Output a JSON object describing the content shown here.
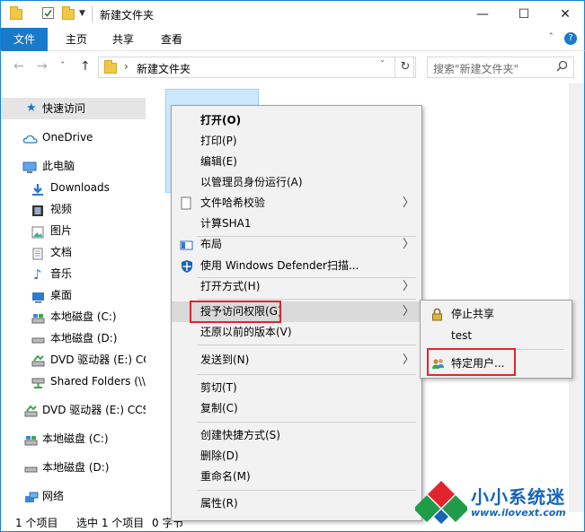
{
  "window": {
    "title": "新建文件夹",
    "min": "—",
    "max": "☐",
    "close": "✕"
  },
  "ribbon": {
    "tabs": [
      "文件",
      "主页",
      "共享",
      "查看"
    ],
    "help": "?",
    "collapse": "ˆ"
  },
  "address": {
    "back": "←",
    "forward": "→",
    "recent": "ˇ",
    "up": "↑",
    "sep": "›",
    "path": "新建文件夹",
    "dropdown": "ˇ",
    "refresh": "↻",
    "search_placeholder": "搜索\"新建文件夹\"",
    "search_icon": "search-icon"
  },
  "nav": {
    "quick_access": "快速访问",
    "onedrive": "OneDrive",
    "this_pc": "此电脑",
    "downloads": "Downloads",
    "videos": "视频",
    "pictures": "图片",
    "documents": "文档",
    "music": "音乐",
    "desktop": "桌面",
    "disk_c": "本地磁盘 (C:)",
    "disk_d": "本地磁盘 (D:)",
    "dvd_e": "DVD 驱动器 (E:) CC",
    "shared": "Shared Folders (\\\\",
    "dvd_e2": "DVD 驱动器 (E:) CCS",
    "disk_c2": "本地磁盘 (C:)",
    "disk_d2": "本地磁盘 (D:)",
    "network": "网络"
  },
  "status": {
    "items": "1 个项目",
    "selected": "选中 1 个项目",
    "size": "0 字节"
  },
  "menu": {
    "open": "打开(O)",
    "print": "打印(P)",
    "edit": "编辑(E)",
    "run_admin": "以管理员身份运行(A)",
    "hash": "文件哈希校验",
    "sha1": "计算SHA1",
    "layout": "布局",
    "defender": "使用 Windows Defender扫描...",
    "open_with": "打开方式(H)",
    "grant_access": "授予访问权限(G)",
    "restore": "还原以前的版本(V)",
    "send_to": "发送到(N)",
    "cut": "剪切(T)",
    "copy": "复制(C)",
    "shortcut": "创建快捷方式(S)",
    "delete": "删除(D)",
    "rename": "重命名(M)",
    "properties": "属性(R)",
    "arrow": "〉"
  },
  "submenu": {
    "stop_sharing": "停止共享",
    "test": "test",
    "specific_users": "特定用户..."
  },
  "watermark": {
    "name": "小小系统迷",
    "url": "www.ilovext.com"
  },
  "colors": {
    "accent": "#1979ca",
    "highlight": "#e0262c"
  }
}
